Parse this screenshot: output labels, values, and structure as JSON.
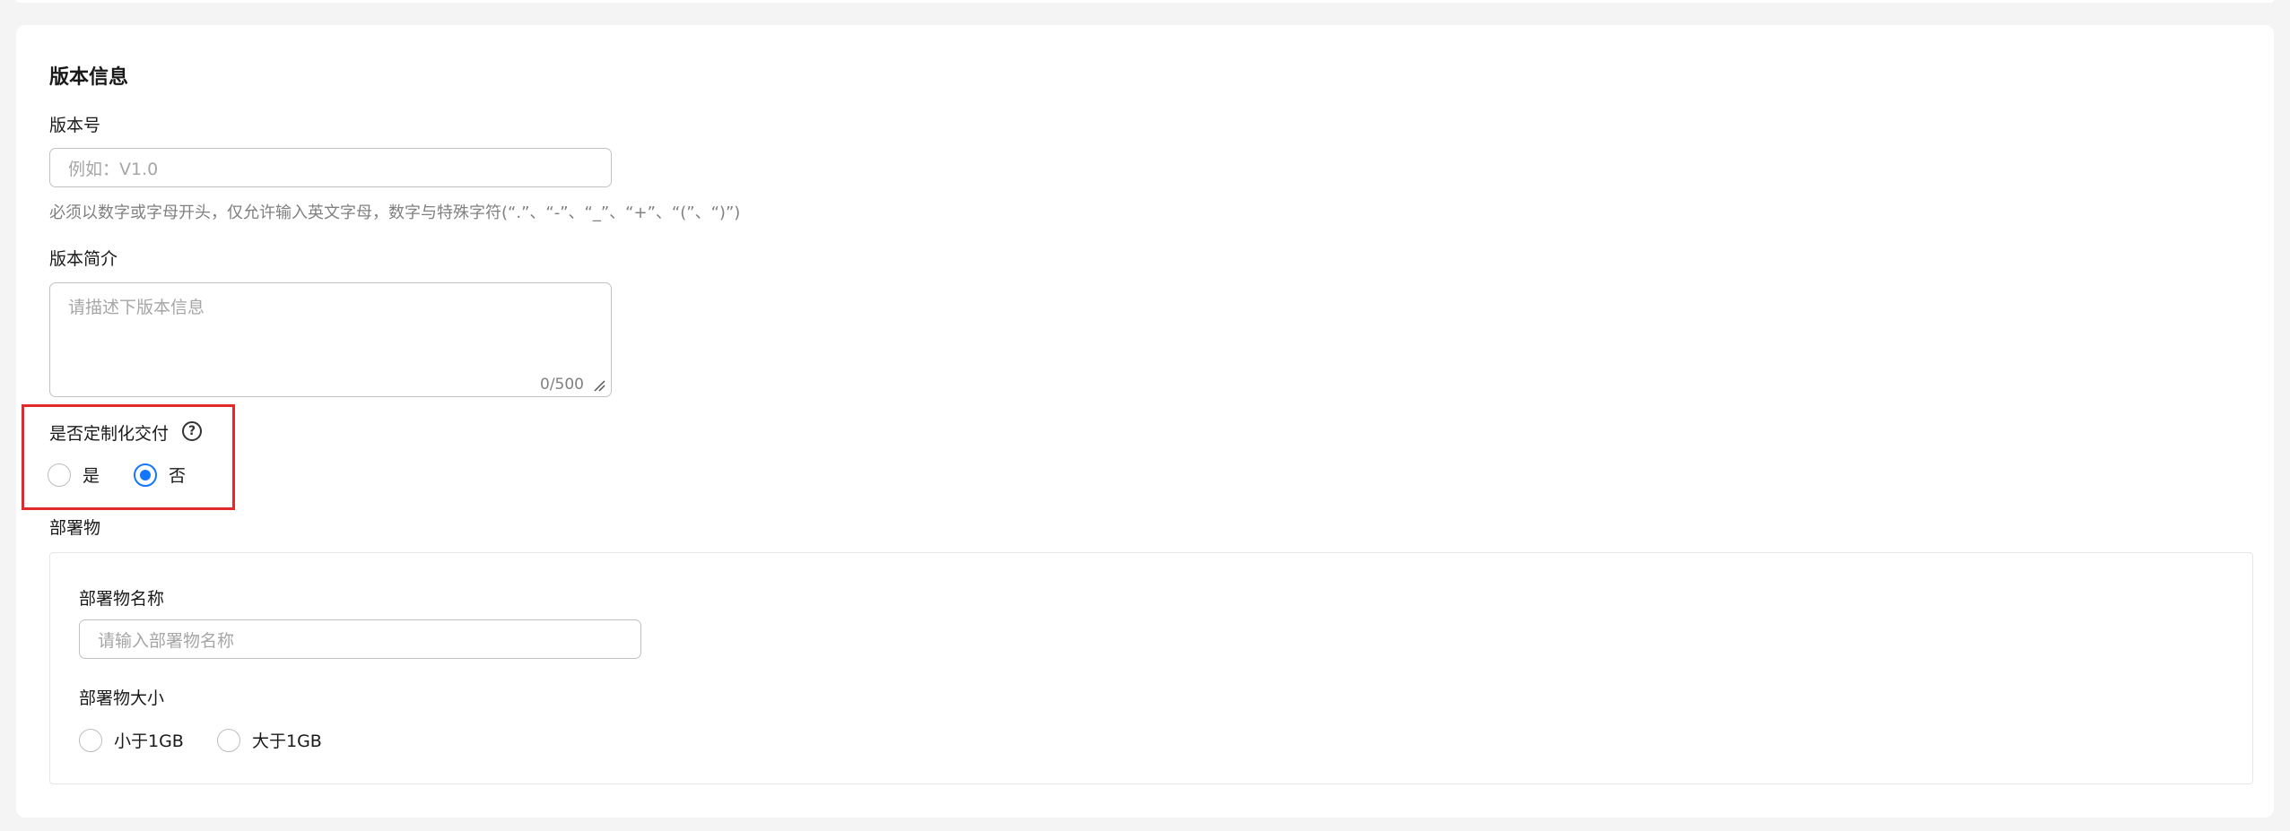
{
  "section": {
    "title": "版本信息"
  },
  "version_number": {
    "label": "版本号",
    "placeholder": "例如：V1.0",
    "help": "必须以数字或字母开头，仅允许输入英文字母，数字与特殊字符(“.”、“-”、“_”、“+”、“(”、“)”)"
  },
  "version_intro": {
    "label": "版本简介",
    "placeholder": "请描述下版本信息",
    "counter": "0/500"
  },
  "custom_delivery": {
    "label": "是否定制化交付",
    "help_icon": "question-circle-icon",
    "options": [
      {
        "label": "是",
        "checked": false
      },
      {
        "label": "否",
        "checked": true
      }
    ],
    "highlight_color": "#e32a2a"
  },
  "deployment": {
    "label": "部署物",
    "name_label": "部署物名称",
    "name_placeholder": "请输入部署物名称",
    "size_label": "部署物大小",
    "size_options": [
      {
        "label": "小于1GB",
        "checked": false
      },
      {
        "label": "大于1GB",
        "checked": false
      }
    ]
  },
  "colors": {
    "accent": "#1476ff",
    "border": "#c2c2c2",
    "background": "#f4f4f4"
  }
}
